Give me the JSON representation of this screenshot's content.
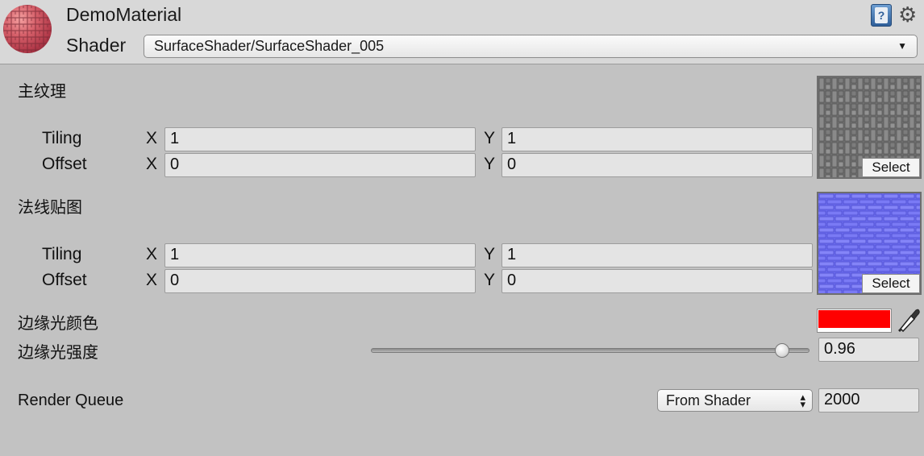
{
  "header": {
    "material_name": "DemoMaterial",
    "shader_label": "Shader",
    "shader_value": "SurfaceShader/SurfaceShader_005",
    "help_icon": "book-help-icon",
    "settings_icon": "gear-icon"
  },
  "main_texture": {
    "title": "主纹理",
    "tiling_label": "Tiling",
    "offset_label": "Offset",
    "x_label": "X",
    "y_label": "Y",
    "tiling_x": "1",
    "tiling_y": "1",
    "offset_x": "0",
    "offset_y": "0",
    "select_label": "Select"
  },
  "normal_map": {
    "title": "法线贴图",
    "tiling_label": "Tiling",
    "offset_label": "Offset",
    "x_label": "X",
    "y_label": "Y",
    "tiling_x": "1",
    "tiling_y": "1",
    "offset_x": "0",
    "offset_y": "0",
    "select_label": "Select"
  },
  "rim_color": {
    "label": "边缘光颜色",
    "color": "#ff0000"
  },
  "rim_power": {
    "label": "边缘光强度",
    "value": "0.96",
    "slider_fraction": 0.96
  },
  "render_queue": {
    "label": "Render Queue",
    "mode": "From Shader",
    "value": "2000"
  }
}
